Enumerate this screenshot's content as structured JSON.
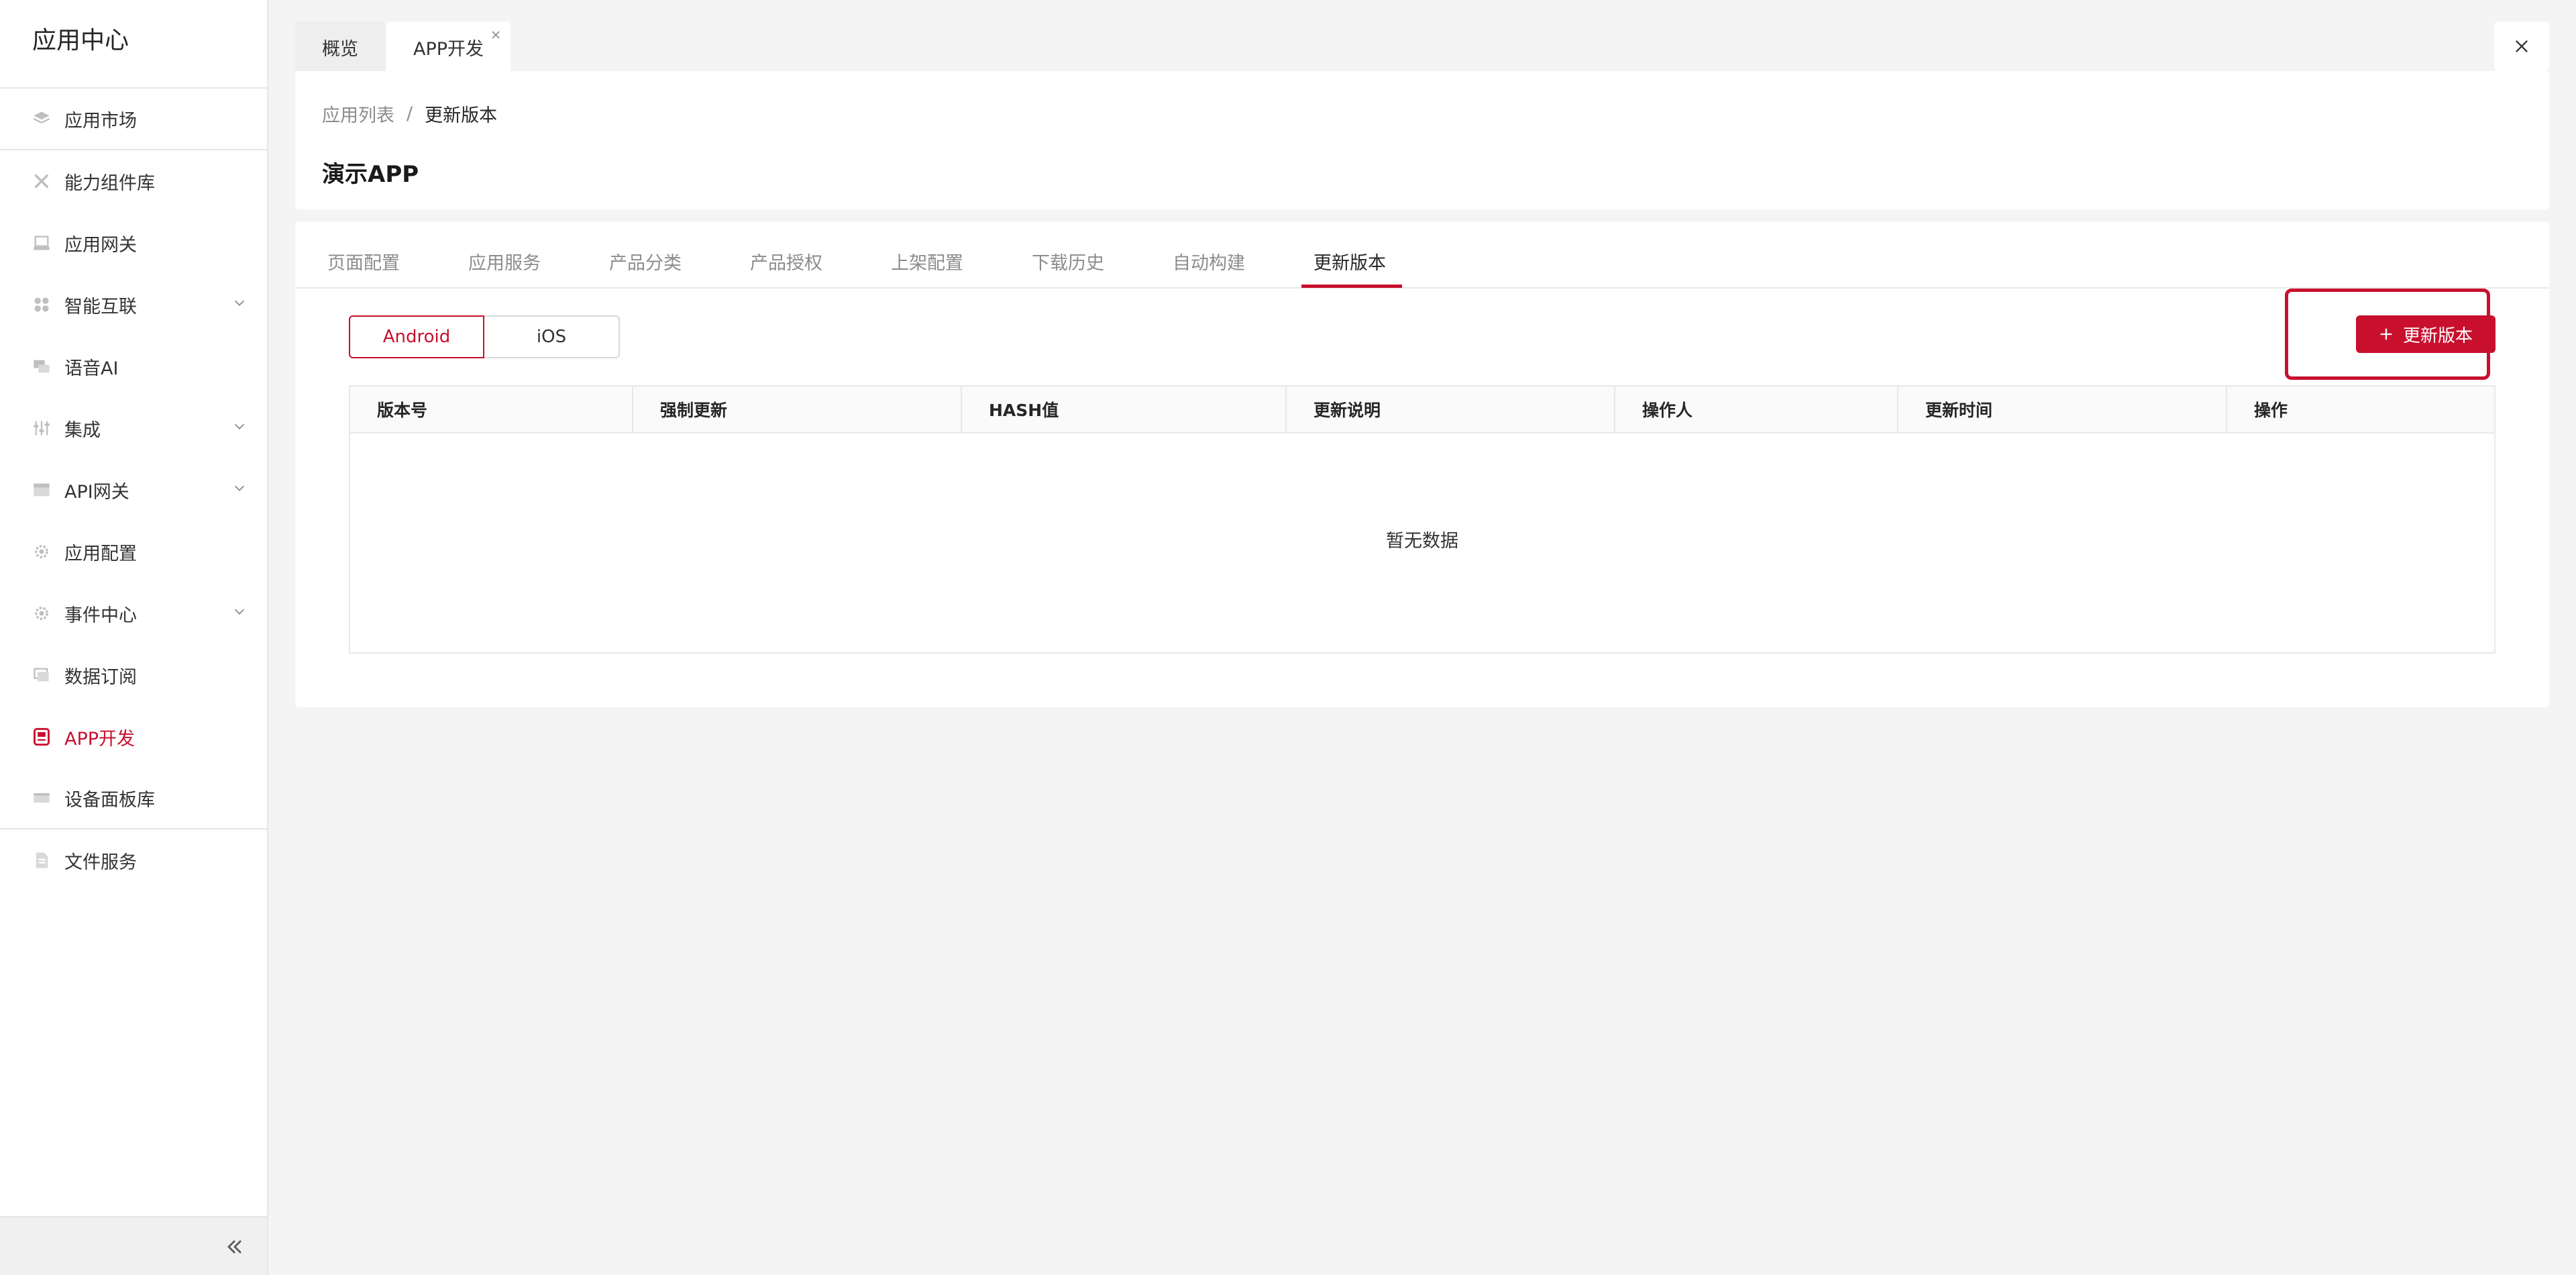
{
  "sidebar": {
    "title": "应用中心",
    "items": [
      {
        "label": "应用市场",
        "icon": "layers-icon"
      },
      {
        "label": "能力组件库",
        "icon": "tools-icon"
      },
      {
        "label": "应用网关",
        "icon": "gateway-icon"
      },
      {
        "label": "智能互联",
        "icon": "grid-icon",
        "expandable": true
      },
      {
        "label": "语音AI",
        "icon": "chat-icon"
      },
      {
        "label": "集成",
        "icon": "sliders-icon",
        "expandable": true
      },
      {
        "label": "API网关",
        "icon": "server-icon",
        "expandable": true
      },
      {
        "label": "应用配置",
        "icon": "gear-icon"
      },
      {
        "label": "事件中心",
        "icon": "gear-icon",
        "expandable": true
      },
      {
        "label": "数据订阅",
        "icon": "monitor-icon"
      },
      {
        "label": "APP开发",
        "icon": "app-icon",
        "active": true
      },
      {
        "label": "设备面板库",
        "icon": "panel-icon"
      },
      {
        "label": "文件服务",
        "icon": "file-icon"
      }
    ]
  },
  "tabs": [
    {
      "label": "概览",
      "active": false
    },
    {
      "label": "APP开发",
      "active": true
    }
  ],
  "breadcrumb": {
    "parent": "应用列表",
    "separator": "/",
    "current": "更新版本"
  },
  "page": {
    "title": "演示APP"
  },
  "subtabs": [
    {
      "label": "页面配置"
    },
    {
      "label": "应用服务"
    },
    {
      "label": "产品分类"
    },
    {
      "label": "产品授权"
    },
    {
      "label": "上架配置"
    },
    {
      "label": "下载历史"
    },
    {
      "label": "自动构建"
    },
    {
      "label": "更新版本",
      "active": true
    }
  ],
  "platform": {
    "options": [
      "Android",
      "iOS"
    ],
    "selected": "Android"
  },
  "actions": {
    "update_label": "更新版本"
  },
  "table": {
    "columns": [
      "版本号",
      "强制更新",
      "HASH值",
      "更新说明",
      "操作人",
      "更新时间",
      "操作"
    ],
    "empty": "暂无数据"
  },
  "colors": {
    "accent": "#c8102e"
  }
}
